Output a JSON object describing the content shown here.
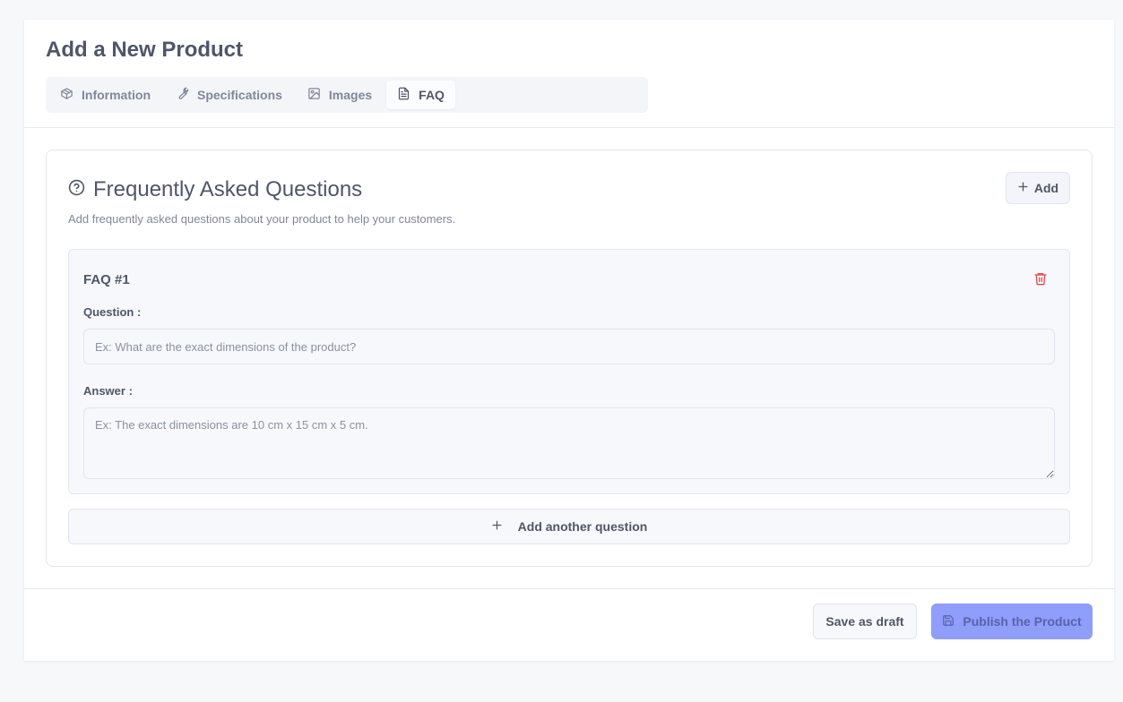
{
  "page": {
    "title": "Add a New Product"
  },
  "tabs": [
    {
      "label": "Information",
      "icon": "box-icon",
      "active": false
    },
    {
      "label": "Specifications",
      "icon": "wrench-icon",
      "active": false
    },
    {
      "label": "Images",
      "icon": "image-icon",
      "active": false
    },
    {
      "label": "FAQ",
      "icon": "document-icon",
      "active": true
    }
  ],
  "faq_section": {
    "title": "Frequently Asked Questions",
    "description": "Add frequently asked questions about your product to help your customers.",
    "add_label": "Add",
    "items": [
      {
        "title": "FAQ #1",
        "question_label": "Question :",
        "question_value": "",
        "question_placeholder": "Ex: What are the exact dimensions of the product?",
        "answer_label": "Answer :",
        "answer_value": "",
        "answer_placeholder": "Ex: The exact dimensions are 10 cm x 15 cm x 5 cm."
      }
    ],
    "add_another_label": "Add another question"
  },
  "footer": {
    "save_draft_label": "Save as draft",
    "publish_label": "Publish the Product"
  },
  "colors": {
    "accent": "#8f9dfb",
    "danger": "#e5484d",
    "text": "#4f5669",
    "muted": "#7f879a"
  }
}
